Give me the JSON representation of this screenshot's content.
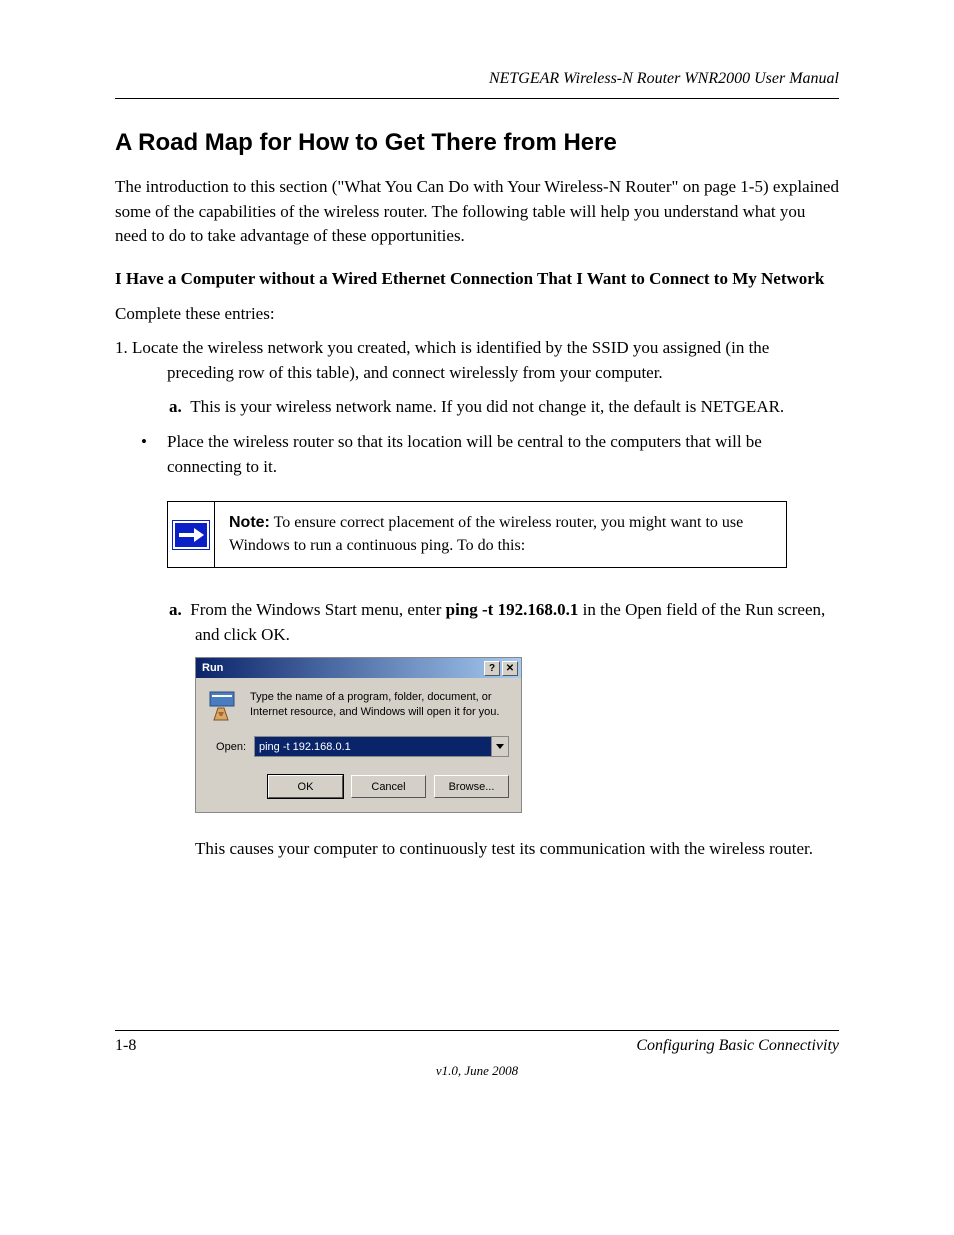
{
  "header": {
    "right": "NETGEAR Wireless-N Router WNR2000 User Manual"
  },
  "section": {
    "title": "A Road Map for How to Get There from Here"
  },
  "intro": "The introduction to this section (\"What You Can Do with Your Wireless-N Router\" on page 1-5) explained some of the capabilities of the wireless router. The following table will help you understand what you need to do to take advantage of these opportunities.",
  "task": {
    "head": "I Have a Computer without a Wired Ethernet Connection That I Want to Connect to My Network",
    "text": "Complete these entries:",
    "step": "1.   Locate the wireless network you created, which is identified by the SSID you assigned (in the preceding row of this table), and connect wirelessly from your computer.",
    "sub_label": "a.",
    "sub_text": "This is your wireless network name. If you did not change it, the default is NETGEAR.",
    "bullet": "Place the wireless router so that its location will be central to the computers that will be connecting to it."
  },
  "note": {
    "label": "Note:",
    "text": " To ensure correct placement of the wireless router, you might want to use Windows to run a continuous ping. To do this:"
  },
  "ping_step": {
    "label": "a.",
    "pre": "From the Windows Start menu, enter ",
    "cmd": "ping -t 192.168.0.1",
    "post": " in the Open field of the Run screen, and click OK."
  },
  "run_dialog": {
    "title": "Run",
    "help": "?",
    "close": "✕",
    "description": "Type the name of a program, folder, document, or Internet resource, and Windows will open it for you.",
    "open_label": "Open:",
    "open_value": "ping -t 192.168.0.1",
    "ok": "OK",
    "cancel": "Cancel",
    "browse": "Browse..."
  },
  "after_dialog": "This causes your computer to continuously test its communication with the wireless router.",
  "footer": {
    "page": "1-8",
    "right": "Configuring Basic Connectivity",
    "version": "v1.0, June 2008"
  }
}
